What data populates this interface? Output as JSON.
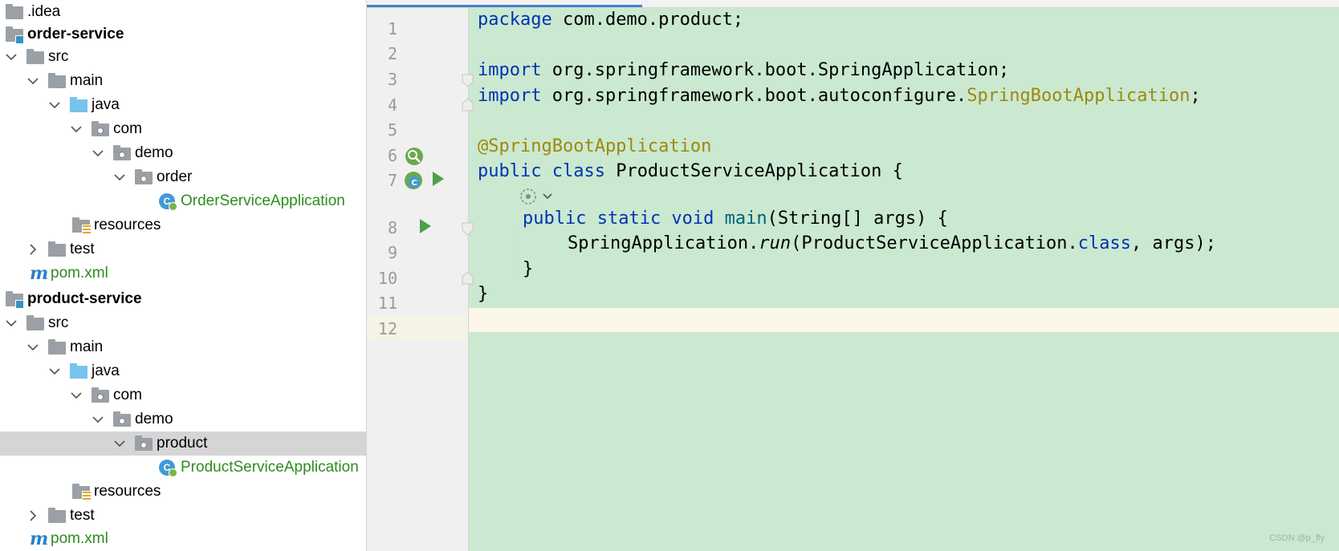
{
  "project_tree": {
    "items": [
      {
        "label": ".idea",
        "type": "folder",
        "expanded": null
      },
      {
        "label": "order-service",
        "type": "module",
        "expanded": null
      },
      {
        "label": "src",
        "type": "folder",
        "expanded": true
      },
      {
        "label": "main",
        "type": "folder",
        "expanded": true
      },
      {
        "label": "java",
        "type": "source-folder",
        "expanded": true
      },
      {
        "label": "com",
        "type": "package",
        "expanded": true
      },
      {
        "label": "demo",
        "type": "package",
        "expanded": true
      },
      {
        "label": "order",
        "type": "package",
        "expanded": true
      },
      {
        "label": "OrderServiceApplication",
        "type": "spring-class",
        "expanded": null
      },
      {
        "label": "resources",
        "type": "resources-folder",
        "expanded": null
      },
      {
        "label": "test",
        "type": "folder",
        "expanded": false
      },
      {
        "label": "pom.xml",
        "type": "maven-file",
        "expanded": null
      },
      {
        "label": "product-service",
        "type": "module",
        "expanded": null
      },
      {
        "label": "src",
        "type": "folder",
        "expanded": true
      },
      {
        "label": "main",
        "type": "folder",
        "expanded": true
      },
      {
        "label": "java",
        "type": "source-folder",
        "expanded": true
      },
      {
        "label": "com",
        "type": "package",
        "expanded": true
      },
      {
        "label": "demo",
        "type": "package",
        "expanded": true
      },
      {
        "label": "product",
        "type": "package",
        "expanded": true,
        "selected": true
      },
      {
        "label": "ProductServiceApplication",
        "type": "spring-class",
        "expanded": null
      },
      {
        "label": "resources",
        "type": "resources-folder",
        "expanded": null
      },
      {
        "label": "test",
        "type": "folder",
        "expanded": false
      },
      {
        "label": "pom.xml",
        "type": "maven-file",
        "expanded": null
      }
    ]
  },
  "editor": {
    "line_numbers": [
      "1",
      "2",
      "3",
      "4",
      "5",
      "6",
      "7",
      "8",
      "9",
      "10",
      "11",
      "12"
    ],
    "lines": {
      "l1": {
        "kw": "package",
        "rest": " com.demo.product;"
      },
      "l3": {
        "kw": "import",
        "rest": " org.springframework.boot.SpringApplication;"
      },
      "l4": {
        "kw": "import",
        "pre": " org.springframework.boot.autoconfigure.",
        "cls": "SpringBootApplication",
        "post": ";"
      },
      "l6": {
        "ann": "@SpringBootApplication"
      },
      "l7": {
        "kw": "public class",
        "rest": " ProductServiceApplication {"
      },
      "l8": {
        "kw": "public static void",
        "meth": "main",
        "rest": "(String[] args) {"
      },
      "l9": {
        "pre": "SpringApplication.",
        "ital": "run",
        "mid": "(ProductServiceApplication.",
        "kw": "class",
        "post": ", args);"
      },
      "l10": {
        "text": "}"
      },
      "l11": {
        "text": "}"
      }
    },
    "current_line": "12"
  },
  "watermark": "CSDN @p_fly",
  "colors": {
    "editor_bg": "#cae9d0",
    "keyword": "#0033b3",
    "annotation": "#9e880d",
    "tree_green": "#2e8b1f",
    "selection": "#d5d5d5"
  }
}
